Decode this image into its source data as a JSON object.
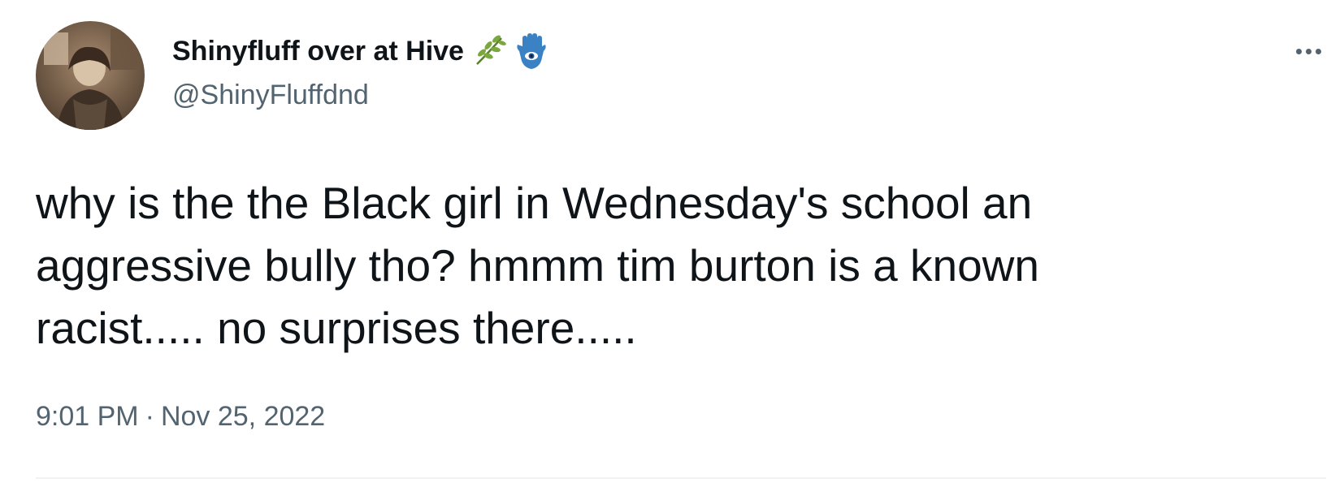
{
  "tweet": {
    "display_name": "Shinyfluff over at Hive",
    "handle": "@ShinyFluffdnd",
    "name_emojis": [
      "herb-icon",
      "hamsa-icon"
    ],
    "text": "why is the the Black girl in Wednesday's school an\naggressive bully tho? hmmm tim burton is a known\nracist..... no surprises there.....",
    "time": "9:01 PM",
    "separator": "·",
    "date": "Nov 25, 2022",
    "more_icon": "more-horizontal-icon"
  },
  "colors": {
    "text_primary": "#0f1419",
    "text_secondary": "#536471",
    "divider": "#eff3f4",
    "hamsa_blue": "#3b82c4",
    "herb_green": "#6a9a3a"
  }
}
